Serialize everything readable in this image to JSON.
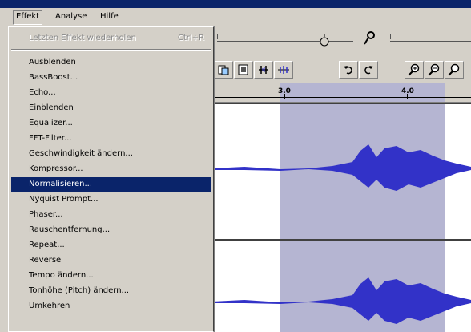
{
  "menubar": {
    "items": [
      {
        "label": "Effekt",
        "active": true
      },
      {
        "label": "Analyse",
        "active": false
      },
      {
        "label": "Hilfe",
        "active": false
      }
    ]
  },
  "effect_menu": {
    "repeat_last": {
      "label": "Letzten Effekt wiederholen",
      "shortcut": "Ctrl+R"
    },
    "items": [
      "Ausblenden",
      "BassBoost...",
      "Echo...",
      "Einblenden",
      "Equalizer...",
      "FFT-Filter...",
      "Geschwindigkeit ändern...",
      "Kompressor...",
      "Normalisieren...",
      "Nyquist Prompt...",
      "Phaser...",
      "Rauschentfernung...",
      "Repeat...",
      "Reverse",
      "Tempo ändern...",
      "Tonhöhe (Pitch) ändern...",
      "Umkehren"
    ],
    "highlighted": "Normalisieren..."
  },
  "ruler": {
    "labels": [
      "3.0",
      "4.0"
    ]
  },
  "colors": {
    "selection": "#b5b5d2",
    "waveform": "#3232c8",
    "highlight": "#0a246a"
  }
}
